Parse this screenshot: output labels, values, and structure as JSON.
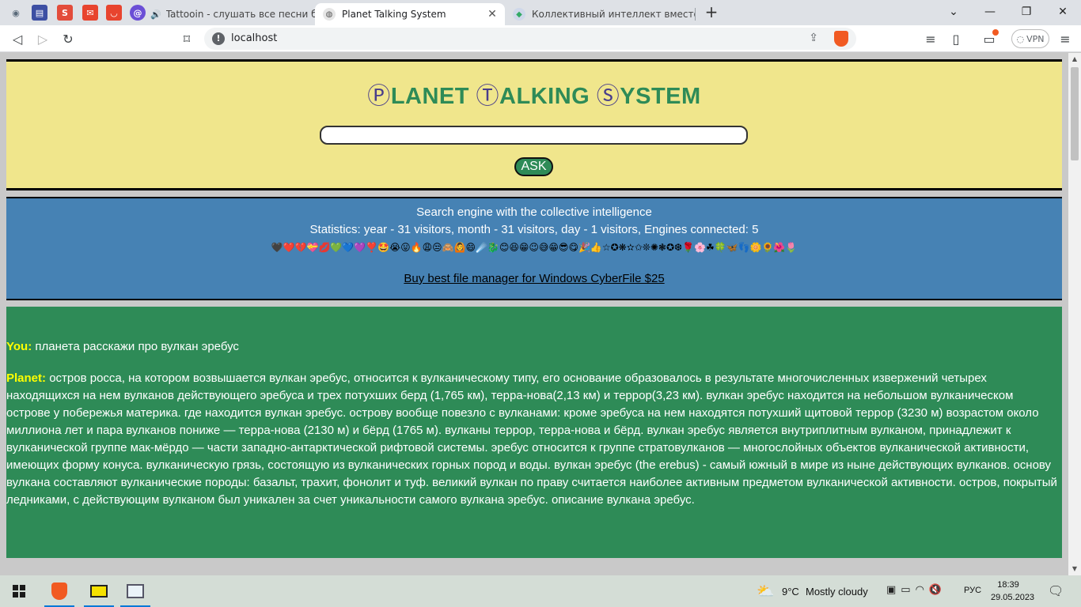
{
  "browser": {
    "pinned_tabs": [
      {
        "icon": "podcast-icon",
        "color": "#5a6a7a"
      },
      {
        "icon": "window-app-icon",
        "color": "#3d4fa3"
      },
      {
        "icon": "s-app-icon",
        "color": "#e34c3b"
      },
      {
        "icon": "mail-app-icon",
        "color": "#e8442e"
      },
      {
        "icon": "pocket-icon",
        "color": "#e8442e"
      },
      {
        "icon": "at-sign-icon",
        "color": "#6b4fd6"
      }
    ],
    "tabs": [
      {
        "title": "Tattooin - слушать все песни бесплатно",
        "active": false
      },
      {
        "title": "Planet Talking System",
        "active": true
      },
      {
        "title": "Коллективный интеллект вместо искусственного",
        "active": false
      }
    ],
    "tab_close_glyph": "✕",
    "new_tab_glyph": "+",
    "window_controls": {
      "dropdown": "⌄",
      "minimize": "—",
      "restore": "❐",
      "close": "✕"
    },
    "address": {
      "url": "localhost",
      "info_glyph": "!"
    },
    "nav": {
      "back": "◁",
      "forward": "▷",
      "reload": "↻",
      "bookmark": "⌑"
    },
    "vpn_label": "VPN",
    "accent_brave": "#f15a22"
  },
  "page": {
    "title": {
      "p_cap": "Ⓟ",
      "p_rest": "LANET ",
      "t_cap": "Ⓣ",
      "t_rest": "ALKING ",
      "s_cap": "Ⓢ",
      "s_rest": "YSTEM"
    },
    "query_value": "",
    "ask_label": "ASK",
    "stats": {
      "tagline": "Search engine with the collective intelligence",
      "statistics": "Statistics: year - 31 visitors, month - 31 visitors, day - 1 visitors, Engines connected: 5",
      "emoji_row": "🖤❤️💔💝💋💚💙💜❣️🤩😭😛🔥😩😒🙈🙆😄☄️🐉😊😆😁😉😅😁😎😋🎉👍☆✪❋✫✩❊✺❃✪❆🌹🌸☘🍀🦋👣🌼🌻🌺🌷",
      "promo_link": "Buy best file manager for Windows CyberFile $25"
    },
    "chat": {
      "you_label": "You:",
      "you_text": "планета расскажи про вулкан эребус",
      "planet_label": "Planet:",
      "planet_text": "остров росса, на котором возвышается вулкан эребус, относится к вулканическому типу, его основание образовалось в результате многочисленных извержений четырех находящихся на нем вулканов действующего эребуса и трех потухших берд (1,765 км), терра-нова(2,13 км) и террор(3,23 км). вулкан эребус находится на небольшом вулканическом острове у побережья материка. где находится вулкан эребус. острову вообще повезло с вулканами: кроме эребуса на нем находятся потухший щитовой террор (3230 м) возрастом около миллиона лет и пара вулканов пониже — терра-нова (2130 м) и бёрд (1765 м). вулканы террор, терра-нова и бёрд. вулкан эребус является внутриплитным вулканом, принадлежит к вулканической группе мак-мёрдо — части западно-антарктической рифтовой системы. эребус относится к группе стратовулканов — многослойных объектов вулканической активности, имеющих форму конуса. вулканическую грязь, состоящую из вулканических горных пород и воды. вулкан эребус (the erebus) - самый южный в мире из ныне действующих вулканов. основу вулкана составляют вулканические породы: базальт, трахит, фонолит и туф. великий вулкан по праву считается наиболее активным предметом вулканической активности. остров, покрытый ледниками, с действующим вулканом был уникален за счет уникальности самого вулкана эребус. описание вулкана эребус."
    },
    "colors": {
      "header_bg": "#f0e68c",
      "title_green": "#2e8b57",
      "title_caps": "#483d8b",
      "stats_bg": "#4682b4",
      "chat_bg": "#2e8b57",
      "speaker_yellow": "#ffff00"
    }
  },
  "taskbar": {
    "weather_temp": "9°C",
    "weather_desc": "Mostly cloudy",
    "language": "РУС",
    "time": "18:39",
    "date": "29.05.2023"
  }
}
